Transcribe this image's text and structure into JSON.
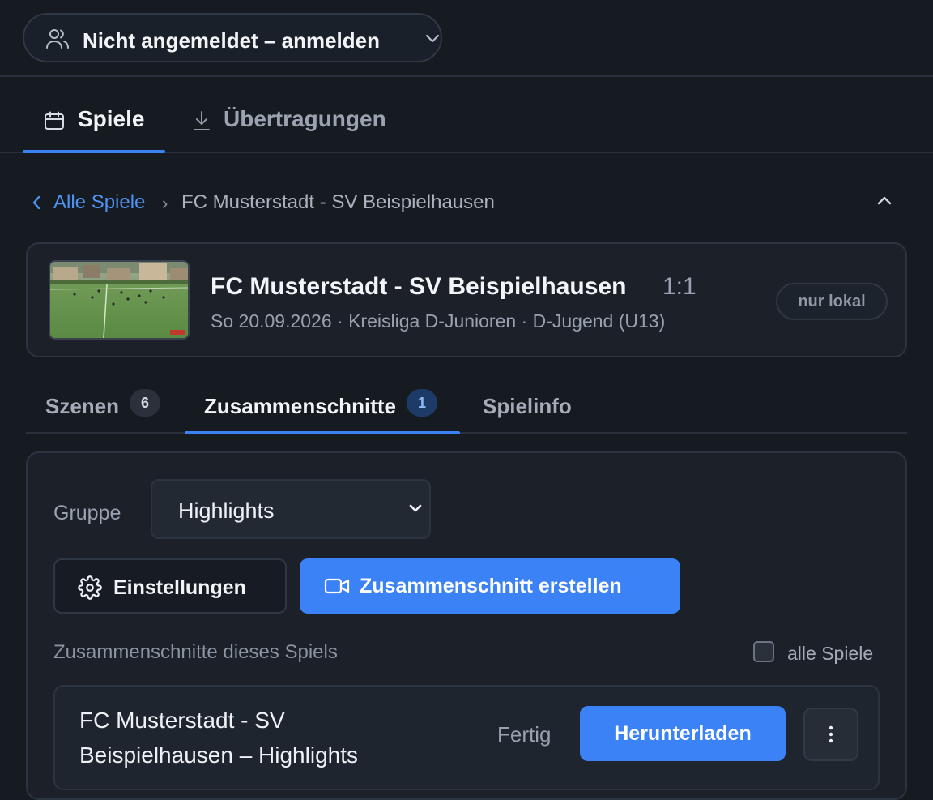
{
  "account": {
    "label": "Nicht angemeldet – anmelden",
    "icon": "users-icon"
  },
  "main_tabs": [
    {
      "label": "Spiele",
      "icon": "calendar-icon",
      "active": true
    },
    {
      "label": "Übertragungen",
      "icon": "download-icon",
      "active": false
    }
  ],
  "breadcrumb": {
    "back_label": "Alle Spiele",
    "separator": "›",
    "current": "FC Musterstadt - SV Beispielhausen"
  },
  "match": {
    "title": "FC Musterstadt - SV Beispielhausen",
    "score": "1:1",
    "meta": "So 20.09.2026 · Kreisliga D-Junioren · D-Jugend (U13)",
    "badge": "nur lokal"
  },
  "sub_tabs": [
    {
      "label": "Szenen",
      "count": "6",
      "active": false
    },
    {
      "label": "Zusammenschnitte",
      "count": "1",
      "active": true
    },
    {
      "label": "Spielinfo",
      "active": false
    }
  ],
  "panel": {
    "group_label": "Gruppe",
    "group_value": "Highlights",
    "settings_label": "Einstellungen",
    "create_label": "Zusammenschnitt erstellen",
    "list_heading": "Zusammenschnitte dieses Spiels",
    "all_games_label": "alle Spiele",
    "all_games_checked": false
  },
  "results": [
    {
      "name": "FC Musterstadt - SV Beispielhausen – Highlights",
      "status": "Fertig",
      "download_label": "Herunterladen"
    }
  ],
  "colors": {
    "accent": "#3b82f6",
    "background": "#161b22",
    "card": "#1b2029",
    "link": "#4e93f0"
  }
}
